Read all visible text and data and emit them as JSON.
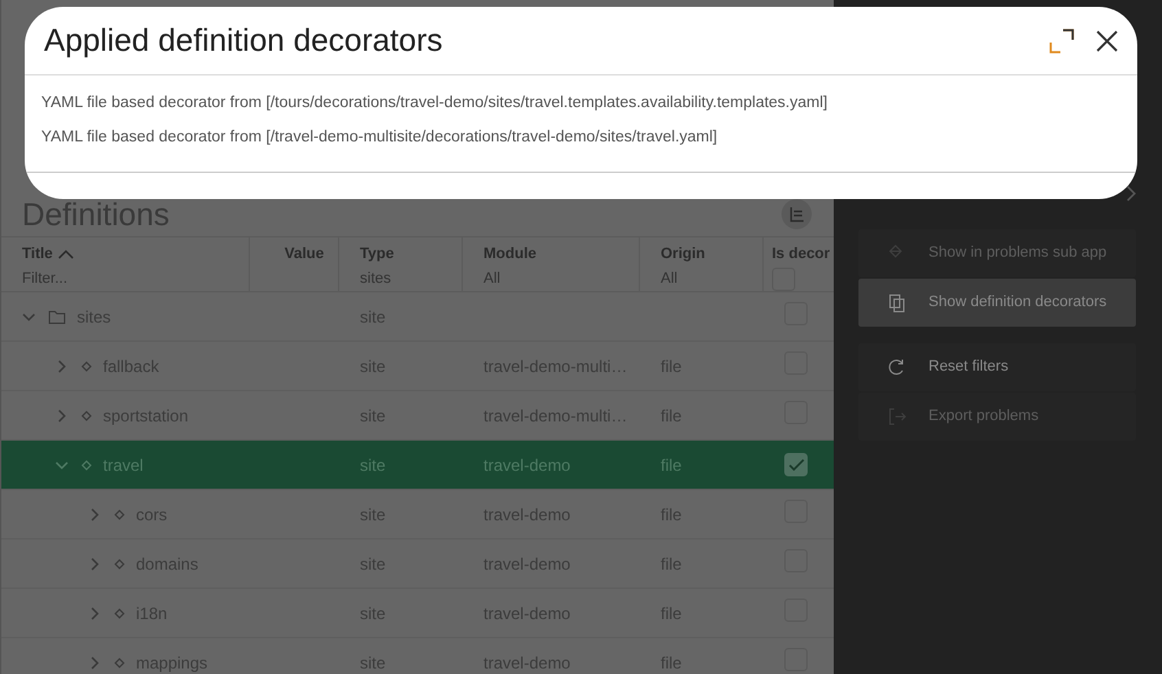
{
  "dialog": {
    "title": "Applied definition decorators",
    "lines": [
      "YAML file based decorator from [/tours/decorations/travel-demo/sites/travel.templates.availability.templates.yaml]",
      "YAML file based decorator from [/travel-demo-multisite/decorations/travel-demo/sites/travel.yaml]"
    ]
  },
  "definitions": {
    "title": "Definitions",
    "columns": [
      {
        "label": "Title",
        "sorted": true,
        "filter_placeholder": "Filter..."
      },
      {
        "label": "Value"
      },
      {
        "label": "Type",
        "filter": "sites"
      },
      {
        "label": "Module",
        "filter": "All"
      },
      {
        "label": "Origin",
        "filter": "All"
      },
      {
        "label": "Is decor",
        "filter_checked": false
      }
    ],
    "rows": [
      {
        "title": "sites",
        "kind": "folder",
        "expanded": true,
        "selected": false,
        "type": "site",
        "checked": false,
        "children": [
          {
            "title": "fallback",
            "kind": "node",
            "expanded": false,
            "selected": false,
            "type": "site",
            "module": "travel-demo-multi…",
            "origin": "file",
            "checked": false
          },
          {
            "title": "sportstation",
            "kind": "node",
            "expanded": false,
            "selected": false,
            "type": "site",
            "module": "travel-demo-multi…",
            "origin": "file",
            "checked": false
          },
          {
            "title": "travel",
            "kind": "node",
            "expanded": true,
            "selected": true,
            "type": "site",
            "module": "travel-demo",
            "origin": "file",
            "checked": true,
            "children": [
              {
                "title": "cors",
                "kind": "node",
                "expanded": false,
                "selected": false,
                "type": "site",
                "module": "travel-demo",
                "origin": "file",
                "checked": false
              },
              {
                "title": "domains",
                "kind": "node",
                "expanded": false,
                "selected": false,
                "type": "site",
                "module": "travel-demo",
                "origin": "file",
                "checked": false
              },
              {
                "title": "i18n",
                "kind": "node",
                "expanded": false,
                "selected": false,
                "type": "site",
                "module": "travel-demo",
                "origin": "file",
                "checked": false
              },
              {
                "title": "mappings",
                "kind": "node",
                "expanded": false,
                "selected": false,
                "type": "site",
                "module": "travel-demo",
                "origin": "file",
                "checked": false
              }
            ]
          }
        ]
      }
    ]
  },
  "actions": [
    {
      "label": "Show in problems sub app",
      "kind": "locate",
      "disabled": true,
      "selected": false
    },
    {
      "label": "Show definition decorators",
      "kind": "copy",
      "disabled": false,
      "selected": true
    },
    {
      "label": "Reset filters",
      "kind": "reset",
      "disabled": false,
      "selected": false,
      "gap_before": true
    },
    {
      "label": "Export problems",
      "kind": "export",
      "disabled": true,
      "selected": false
    }
  ]
}
